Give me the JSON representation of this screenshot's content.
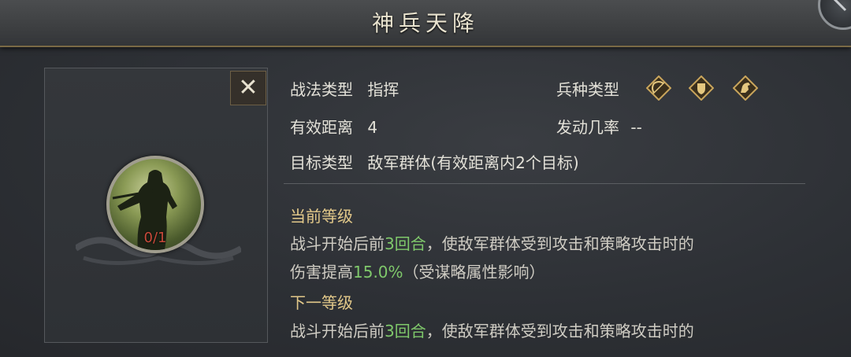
{
  "header": {
    "title": "神兵天降"
  },
  "close": {
    "symbol": "✕"
  },
  "portrait": {
    "level_text": "0/1"
  },
  "info": {
    "tactic_type_label": "战法类型",
    "tactic_type_value": "指挥",
    "troop_type_label": "兵种类型",
    "troop_icons": [
      "archer-icon",
      "shield-infantry-icon",
      "cavalry-icon"
    ],
    "range_label": "有效距离",
    "range_value": "4",
    "trigger_label": "发动几率",
    "trigger_value": "--",
    "target_label": "目标类型",
    "target_value": "敌军群体(有效距离内2个目标)"
  },
  "current_level": {
    "heading": "当前等级",
    "line1_prefix": "战斗开始后前",
    "line1_highlight": "3回合",
    "line1_suffix": "，使敌军群体受到攻击和策略攻击时的",
    "line2_prefix": "伤害提高",
    "line2_highlight": "15.0%",
    "line2_suffix": "（受谋略属性影响）"
  },
  "next_level": {
    "heading": "下一等级",
    "line1_prefix": "战斗开始后前",
    "line1_highlight": "3回合",
    "line1_suffix": "，使敌军群体受到攻击和策略攻击时的"
  },
  "colors": {
    "highlight": "#7fc86b",
    "heading": "#e3c98a",
    "level_text": "#c84a3a",
    "gold_border": "#7a6a45"
  }
}
